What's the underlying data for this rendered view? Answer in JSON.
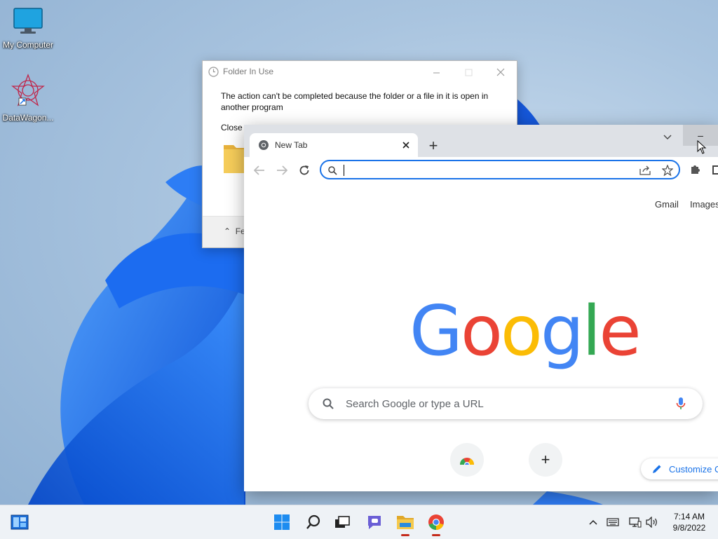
{
  "desktop": {
    "icons": [
      {
        "label": "My Computer"
      },
      {
        "label": "DataWagon..."
      }
    ]
  },
  "dialog": {
    "title": "Folder In Use",
    "message": "The action can't be completed because the folder or a file in it is open in another program",
    "close_prompt": "Close",
    "footer_label": "Fe"
  },
  "chrome": {
    "tab_title": "New Tab",
    "new_tab_symbol": "+",
    "minimize_symbol": "–",
    "top_links": {
      "gmail": "Gmail",
      "images": "Images"
    },
    "search_placeholder": "Search Google or type a URL",
    "customize_label": "Customize C",
    "add_shortcut_symbol": "+",
    "logo": {
      "letters": [
        "G",
        "o",
        "o",
        "g",
        "l",
        "e"
      ],
      "colors": [
        "#4285f4",
        "#ea4335",
        "#fbbc05",
        "#4285f4",
        "#34a853",
        "#ea4335"
      ]
    },
    "accent": "#1a73e8"
  },
  "taskbar": {
    "time": "7:14 AM",
    "date": "9/8/2022",
    "running_indicator_color": "#c42b1c"
  }
}
